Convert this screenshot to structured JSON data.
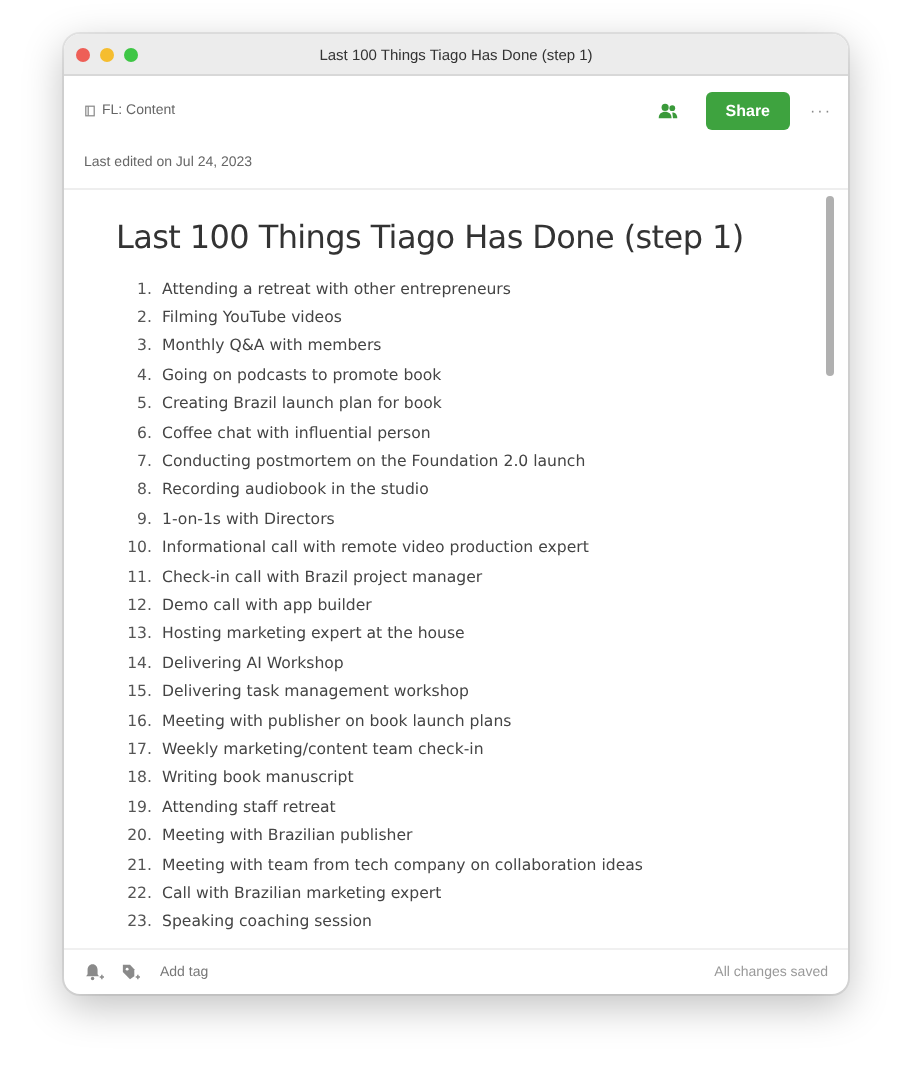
{
  "window": {
    "title": "Last 100 Things Tiago Has Done (step 1)"
  },
  "toolbar": {
    "notebook": "FL: Content",
    "share": "Share",
    "more": "···"
  },
  "last_edited": "Last edited on Jul 24, 2023",
  "note": {
    "title": "Last 100 Things Tiago Has Done (step 1)",
    "items": [
      {
        "number": "1.",
        "text": "Attending a retreat with other entrepreneurs"
      },
      {
        "number": "2.",
        "text": "Filming YouTube videos"
      },
      {
        "number": "3.",
        "text": "Monthly Q&A with members"
      },
      {
        "number": "4.",
        "text": "Going on podcasts to promote book"
      },
      {
        "number": "5.",
        "text": "Creating Brazil launch plan for book"
      },
      {
        "number": "6.",
        "text": "Coffee chat with influential person"
      },
      {
        "number": "7.",
        "text": "Conducting postmortem on the Foundation 2.0 launch"
      },
      {
        "number": "8.",
        "text": "Recording audiobook in the studio"
      },
      {
        "number": "9.",
        "text": "1-on-1s with Directors"
      },
      {
        "number": "10.",
        "text": "Informational call with remote video production expert"
      },
      {
        "number": "11.",
        "text": "Check-in call with Brazil project manager"
      },
      {
        "number": "12.",
        "text": "Demo call with app builder"
      },
      {
        "number": "13.",
        "text": "Hosting marketing expert at the house"
      },
      {
        "number": "14.",
        "text": "Delivering AI Workshop"
      },
      {
        "number": "15.",
        "text": "Delivering task management workshop"
      },
      {
        "number": "16.",
        "text": "Meeting with publisher on book launch plans"
      },
      {
        "number": "17.",
        "text": "Weekly marketing/content team check-in"
      },
      {
        "number": "18.",
        "text": "Writing book manuscript"
      },
      {
        "number": "19.",
        "text": "Attending staff retreat"
      },
      {
        "number": "20.",
        "text": "Meeting with Brazilian publisher"
      },
      {
        "number": "21.",
        "text": "Meeting with team from tech company on collaboration ideas"
      },
      {
        "number": "22.",
        "text": "Call with Brazilian marketing expert"
      },
      {
        "number": "23.",
        "text": "Speaking coaching session"
      }
    ]
  },
  "footer": {
    "add_tag": "Add tag",
    "status": "All changes saved"
  }
}
